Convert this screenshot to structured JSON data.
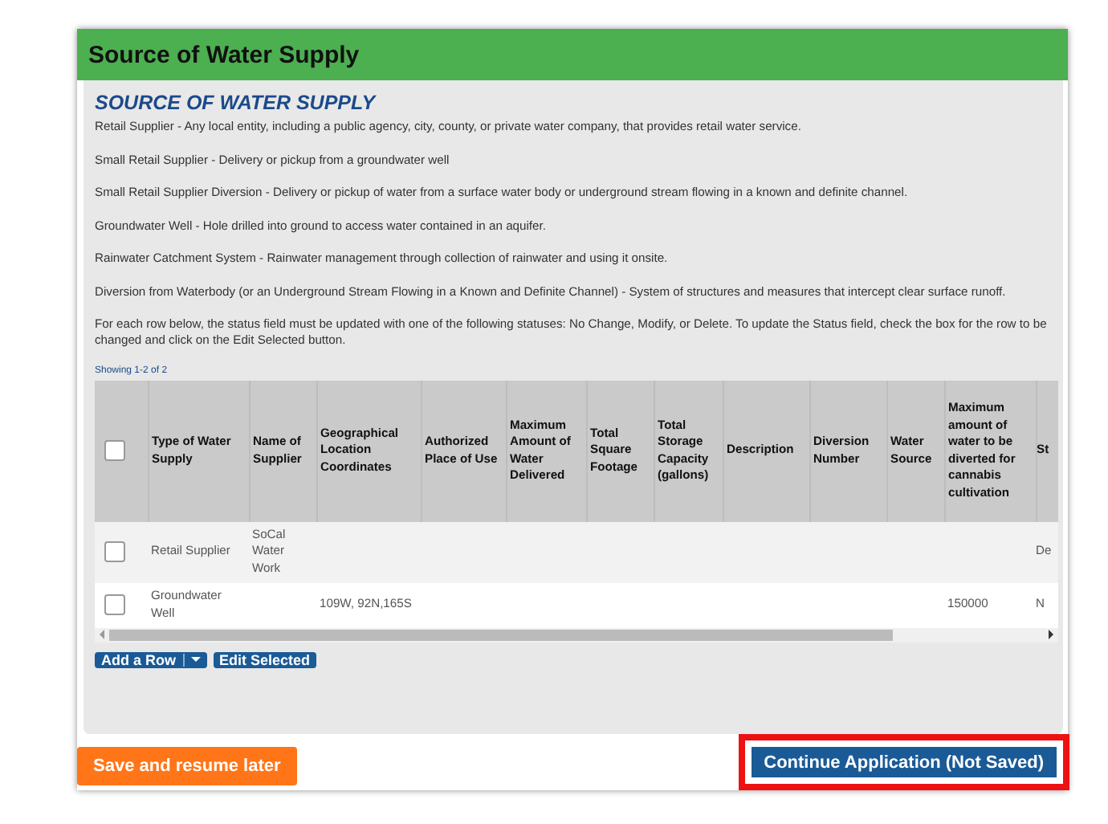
{
  "panel": {
    "title": "Source of Water Supply"
  },
  "section": {
    "heading": "SOURCE OF WATER SUPPLY",
    "paragraphs": [
      "Retail Supplier - Any local entity, including a public agency, city, county, or private water company, that provides retail water service.",
      "Small Retail Supplier - Delivery or pickup from a groundwater well",
      "Small Retail Supplier Diversion - Delivery or pickup of water from a surface water body or underground stream flowing in a known and definite channel.",
      "Groundwater Well - Hole drilled into ground to access water contained in an aquifer.",
      "Rainwater Catchment System - Rainwater management through collection of rainwater and using it onsite.",
      "Diversion from Waterbody (or an Underground Stream Flowing in a Known and Definite Channel) - System of structures and measures that intercept clear surface runoff.",
      "For each row below, the status field must be updated with one of the following statuses: No Change, Modify, or Delete. To update the Status field, check the box for the row to be changed and click on the Edit Selected button."
    ]
  },
  "table": {
    "showing": "Showing 1-2 of 2",
    "select_all_checked": false,
    "columns": [
      "Type of Water Supply",
      "Name of Supplier",
      "Geographical Location Coordinates",
      "Authorized Place of Use",
      "Maximum Amount of Water Delivered",
      "Total Square Footage",
      "Total Storage Capacity (gallons)",
      "Description",
      "Diversion Number",
      "Water Source",
      "Maximum amount of water to be diverted for cannabis cultivation",
      "St"
    ],
    "rows": [
      {
        "checked": false,
        "cells": [
          "Retail Supplier",
          "SoCal Water Work",
          "",
          "",
          "",
          "",
          "",
          "",
          "",
          "",
          "",
          "De"
        ]
      },
      {
        "checked": false,
        "cells": [
          "Groundwater Well",
          "",
          "109W, 92N,165S",
          "",
          "",
          "",
          "",
          "",
          "",
          "",
          "150000",
          "N"
        ]
      }
    ]
  },
  "actions": {
    "add_row": "Add a Row",
    "edit_selected": "Edit Selected"
  },
  "footer": {
    "save": "Save and resume later",
    "continue": "Continue Application (Not Saved)",
    "continue_highlighted": true
  }
}
